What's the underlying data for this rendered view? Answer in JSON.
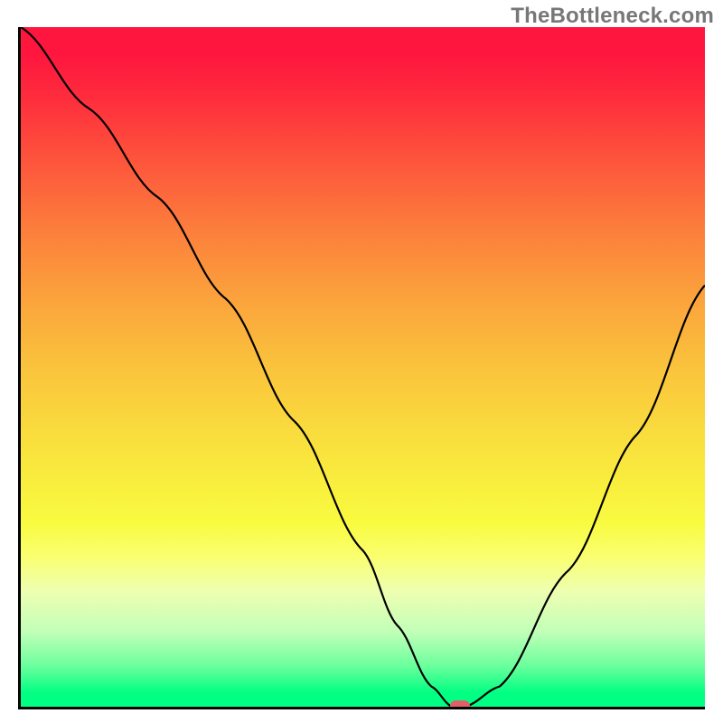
{
  "watermark": "TheBottleneck.com",
  "chart_data": {
    "type": "line",
    "title": "",
    "xlabel": "",
    "ylabel": "",
    "xlim": [
      0,
      100
    ],
    "ylim": [
      0,
      100
    ],
    "x": [
      0,
      10,
      20,
      30,
      40,
      50,
      55,
      60,
      63,
      65,
      70,
      80,
      90,
      100
    ],
    "values": [
      100,
      88,
      75,
      60,
      42,
      23,
      12,
      3,
      0,
      0,
      3,
      20,
      40,
      62
    ],
    "minimum_point": {
      "x": 64,
      "y": 0
    },
    "background_gradient": {
      "top": "#fe163e",
      "middle": "#f9f03e",
      "bottom": "#00ff82"
    },
    "marker_color": "#E0606A"
  }
}
